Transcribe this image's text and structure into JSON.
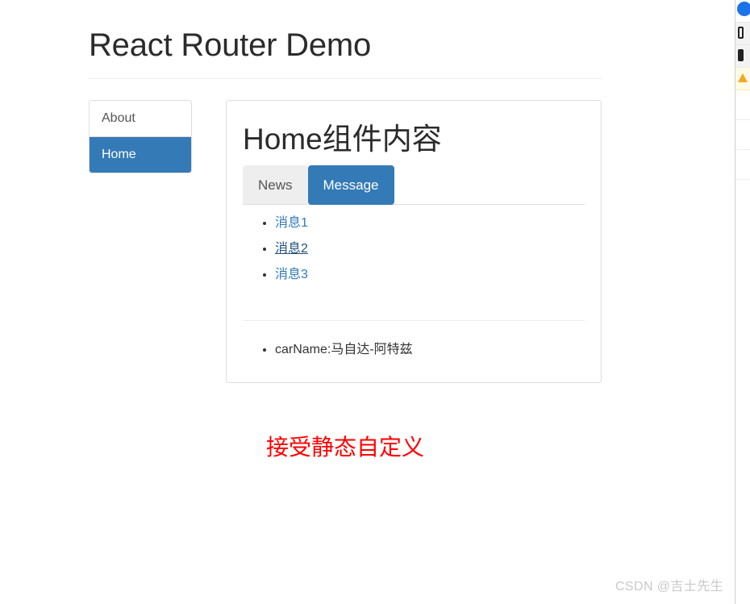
{
  "page": {
    "title": "React Router Demo"
  },
  "sidebar": {
    "items": [
      {
        "label": "About",
        "active": false
      },
      {
        "label": "Home",
        "active": true
      }
    ]
  },
  "content": {
    "heading": "Home组件内容",
    "tabs": [
      {
        "label": "News",
        "state": "hovered"
      },
      {
        "label": "Message",
        "state": "active"
      }
    ],
    "messages": [
      {
        "label": "消息1",
        "hovered": false
      },
      {
        "label": "消息2",
        "hovered": true
      },
      {
        "label": "消息3",
        "hovered": false
      }
    ],
    "detail_items": [
      "carName:马自达-阿特兹"
    ]
  },
  "footer": {
    "red_note": "接受静态自定义"
  },
  "watermark": {
    "text": "CSDN @吉士先生"
  },
  "devtools": {
    "rows": [
      {
        "icon": "blue-circle-icon",
        "style": "plain"
      },
      {
        "icon": "info-message-icon",
        "style": "gray"
      },
      {
        "icon": "error-message-icon",
        "style": "gray"
      },
      {
        "icon": "warning-triangle-icon",
        "style": "warn"
      }
    ]
  },
  "colors": {
    "primary": "#337ab7",
    "link": "#337ab7",
    "border": "#dddddd",
    "rule": "#eeeeee",
    "tab_hover_bg": "#eeeeee",
    "red_note": "#ff0000",
    "watermark": "#c9c9c9",
    "devtools_blue": "#1a73e8",
    "devtools_warn_bg": "#fffbe5",
    "devtools_warn_icon": "#f5a623"
  }
}
